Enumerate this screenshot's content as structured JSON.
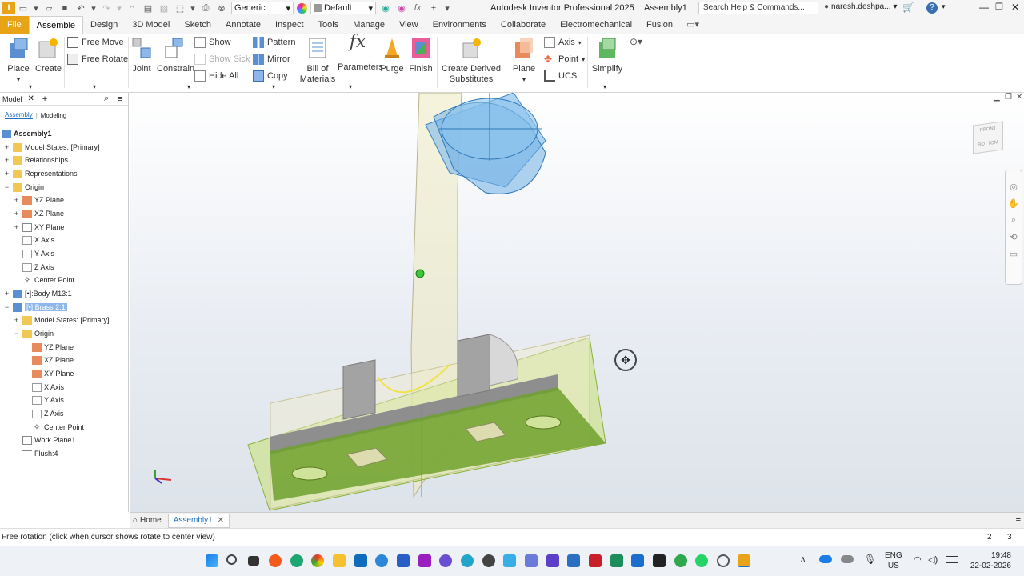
{
  "titlebar": {
    "appearance_combo": "Generic",
    "material_combo": "Default",
    "app_title": "Autodesk Inventor Professional 2025",
    "doc_title": "Assembly1",
    "search_placeholder": "Search Help & Commands...",
    "user": "naresh.deshpa..."
  },
  "tabs": [
    "File",
    "Assemble",
    "Design",
    "3D Model",
    "Sketch",
    "Annotate",
    "Inspect",
    "Tools",
    "Manage",
    "View",
    "Environments",
    "Collaborate",
    "Electromechanical",
    "Fusion"
  ],
  "ribbon": {
    "place": "Place",
    "create": "Create",
    "free_move": "Free Move",
    "free_rotate": "Free Rotate",
    "joint": "Joint",
    "constrain": "Constrain",
    "show": "Show",
    "show_sick": "Show Sick",
    "hide_all": "Hide All",
    "pattern": "Pattern",
    "mirror": "Mirror",
    "copy": "Copy",
    "bom_line1": "Bill of",
    "bom_line2": "Materials",
    "parameters": "Parameters",
    "purge": "Purge",
    "finish": "Finish",
    "derived_line1": "Create Derived",
    "derived_line2": "Substitutes",
    "plane": "Plane",
    "axis": "Axis",
    "point": "Point",
    "ucs": "UCS",
    "simplify": "Simplify"
  },
  "browser": {
    "tab_model": "Model",
    "sub_assembly": "Assembly",
    "sub_modeling": "Modeling",
    "items": [
      "Assembly1",
      "Model States: [Primary]",
      "Relationships",
      "Representations",
      "Origin",
      "YZ Plane",
      "XZ Plane",
      "XY Plane",
      "X Axis",
      "Y Axis",
      "Z Axis",
      "Center Point",
      "[•]:Body M13:1",
      "[•]:Brass 2:1",
      "Model States: [Primary]",
      "Origin",
      "YZ Plane",
      "XZ Plane",
      "XY Plane",
      "X Axis",
      "Y Axis",
      "Z Axis",
      "Center Point",
      "Work Plane1",
      "Flush:4"
    ]
  },
  "viewcube": {
    "front": "FRONT",
    "bottom": "BOTTOM"
  },
  "doctabs": {
    "home": "Home",
    "assembly": "Assembly1"
  },
  "status": {
    "message": "Free rotation (click when cursor shows rotate to center view)",
    "count1": "2",
    "count2": "3"
  },
  "taskbar": {
    "lang": "ENG",
    "region": "US",
    "time": "19:48",
    "date": "22-02-2026"
  }
}
